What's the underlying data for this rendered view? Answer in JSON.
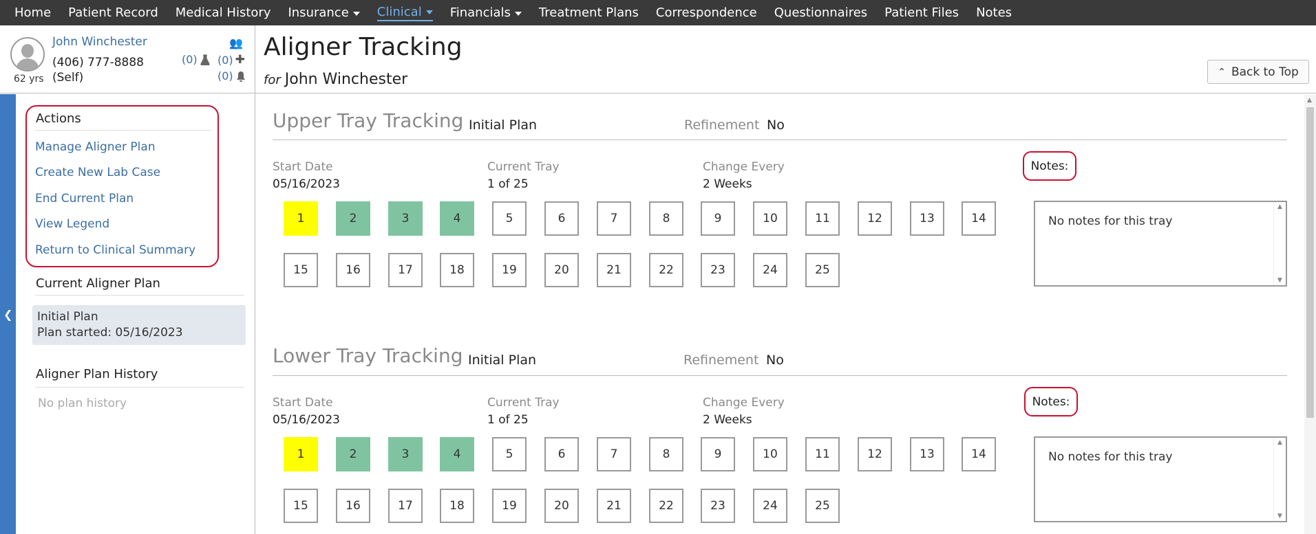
{
  "nav": {
    "items": [
      {
        "label": "Home",
        "dropdown": false,
        "active": false
      },
      {
        "label": "Patient Record",
        "dropdown": false,
        "active": false
      },
      {
        "label": "Medical History",
        "dropdown": false,
        "active": false
      },
      {
        "label": "Insurance",
        "dropdown": true,
        "active": false
      },
      {
        "label": "Clinical",
        "dropdown": true,
        "active": true
      },
      {
        "label": "Financials",
        "dropdown": true,
        "active": false
      },
      {
        "label": "Treatment Plans",
        "dropdown": false,
        "active": false
      },
      {
        "label": "Correspondence",
        "dropdown": false,
        "active": false
      },
      {
        "label": "Questionnaires",
        "dropdown": false,
        "active": false
      },
      {
        "label": "Patient Files",
        "dropdown": false,
        "active": false
      },
      {
        "label": "Notes",
        "dropdown": false,
        "active": false
      }
    ]
  },
  "patient": {
    "name": "John Winchester",
    "phone": "(406) 777-8888",
    "relation": "(Self)",
    "age": "62 yrs",
    "lab_count": "(0)",
    "medical_count": "(0)",
    "alert_count": "(0)"
  },
  "page": {
    "title": "Aligner Tracking",
    "for_label": "for",
    "for_name": "John Winchester",
    "back_to_top": "Back to Top"
  },
  "sidebar": {
    "actions_heading": "Actions",
    "actions": [
      "Manage Aligner Plan",
      "Create New Lab Case",
      "End Current Plan",
      "View Legend",
      "Return to Clinical Summary"
    ],
    "current_plan_heading": "Current Aligner Plan",
    "current_plan_name": "Initial Plan",
    "current_plan_started": "Plan started: 05/16/2023",
    "history_heading": "Aligner Plan History",
    "history_empty": "No plan history"
  },
  "upper": {
    "title": "Upper Tray Tracking",
    "plan": "Initial Plan",
    "refinement_label": "Refinement",
    "refinement_value": "No",
    "start_date_label": "Start Date",
    "start_date": "05/16/2023",
    "current_tray_label": "Current Tray",
    "current_tray": "1 of 25",
    "change_every_label": "Change Every",
    "change_every": "2 Weeks",
    "notes_label": "Notes:",
    "notes_text": "No notes for this tray",
    "current_tray_number": 1,
    "completed_trays": [
      2,
      3,
      4
    ],
    "tray_count": 25
  },
  "lower": {
    "title": "Lower Tray Tracking",
    "plan": "Initial Plan",
    "refinement_label": "Refinement",
    "refinement_value": "No",
    "start_date_label": "Start Date",
    "start_date": "05/16/2023",
    "current_tray_label": "Current Tray",
    "current_tray": "1 of 25",
    "change_every_label": "Change Every",
    "change_every": "2 Weeks",
    "notes_label": "Notes:",
    "notes_text": "No notes for this tray",
    "current_tray_number": 1,
    "completed_trays": [
      2,
      3,
      4
    ],
    "tray_count": 25
  },
  "colors": {
    "current_tray": "#ffff00",
    "completed_tray": "#80c3a0",
    "link": "#3b6ea5",
    "highlight_outline": "#c8102e"
  },
  "icons": {
    "lab": "flask-icon",
    "medical": "plus-icon",
    "alert": "bell-icon",
    "people": "people-icon",
    "back_to_top": "chevron-up-icon",
    "collapse": "chevron-left-icon"
  }
}
